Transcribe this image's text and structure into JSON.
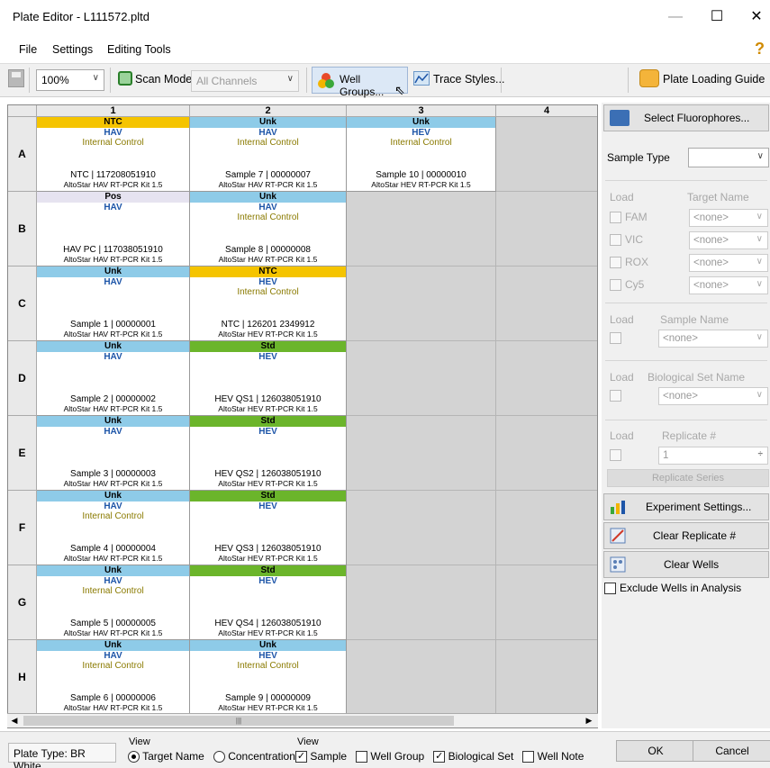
{
  "window": {
    "title": "Plate Editor - L111572.pltd",
    "minimize": "—",
    "maximize": "☐",
    "close": "✕"
  },
  "menu": {
    "items": [
      "File",
      "Settings",
      "Editing Tools"
    ],
    "help": "?"
  },
  "toolbar": {
    "zoom": "100%",
    "scan_mode_label": "Scan Mode",
    "channels": "All Channels",
    "well_groups": "Well Groups...",
    "trace_styles": "Trace Styles...",
    "plate_loading_guide": "Plate Loading Guide"
  },
  "grid": {
    "columns": [
      "1",
      "2",
      "3",
      "4"
    ],
    "rows": [
      "A",
      "B",
      "C",
      "D",
      "E",
      "F",
      "G",
      "H"
    ],
    "wells": [
      [
        {
          "type": "NTC",
          "color": "#f5c400",
          "t1": "HAV",
          "t2": "Internal Control",
          "s1": "NTC | 117208051910",
          "s2": "AltoStar HAV RT-PCR Kit 1.5"
        },
        {
          "type": "Unk",
          "color": "#8ecbe8",
          "t1": "HAV",
          "t2": "Internal Control",
          "s1": "Sample 7 | 00000007",
          "s2": "AltoStar HAV RT-PCR Kit 1.5"
        },
        {
          "type": "Unk",
          "color": "#8ecbe8",
          "t1": "HEV",
          "t2": "Internal Control",
          "s1": "Sample 10 | 00000010",
          "s2": "AltoStar HEV RT-PCR Kit 1.5"
        },
        null
      ],
      [
        {
          "type": "Pos",
          "color": "#e6e3f0",
          "t1": "HAV",
          "t2": "",
          "s1": "HAV PC | 117038051910",
          "s2": "AltoStar HAV RT-PCR Kit 1.5"
        },
        {
          "type": "Unk",
          "color": "#8ecbe8",
          "t1": "HAV",
          "t2": "Internal Control",
          "s1": "Sample 8 | 00000008",
          "s2": "AltoStar HAV RT-PCR Kit 1.5"
        },
        null,
        null
      ],
      [
        {
          "type": "Unk",
          "color": "#8ecbe8",
          "t1": "HAV",
          "t2": "",
          "s1": "Sample 1 | 00000001",
          "s2": "AltoStar HAV RT-PCR Kit 1.5"
        },
        {
          "type": "NTC",
          "color": "#f5c400",
          "t1": "HEV",
          "t2": "Internal Control",
          "s1": "NTC | 126201 2349912",
          "s2": "AltoStar HEV RT-PCR Kit 1.5"
        },
        null,
        null
      ],
      [
        {
          "type": "Unk",
          "color": "#8ecbe8",
          "t1": "HAV",
          "t2": "",
          "s1": "Sample 2 | 00000002",
          "s2": "AltoStar HAV RT-PCR Kit 1.5"
        },
        {
          "type": "Std",
          "color": "#6bb52b",
          "t1": "HEV",
          "t2": "",
          "s1": "HEV QS1 | 126038051910",
          "s2": "AltoStar HEV RT-PCR Kit 1.5"
        },
        null,
        null
      ],
      [
        {
          "type": "Unk",
          "color": "#8ecbe8",
          "t1": "HAV",
          "t2": "",
          "s1": "Sample 3 | 00000003",
          "s2": "AltoStar HAV RT-PCR Kit 1.5"
        },
        {
          "type": "Std",
          "color": "#6bb52b",
          "t1": "HEV",
          "t2": "",
          "s1": "HEV QS2 | 126038051910",
          "s2": "AltoStar HEV RT-PCR Kit 1.5"
        },
        null,
        null
      ],
      [
        {
          "type": "Unk",
          "color": "#8ecbe8",
          "t1": "HAV",
          "t2": "Internal Control",
          "s1": "Sample 4 | 00000004",
          "s2": "AltoStar HAV RT-PCR Kit 1.5"
        },
        {
          "type": "Std",
          "color": "#6bb52b",
          "t1": "HEV",
          "t2": "",
          "s1": "HEV QS3 | 126038051910",
          "s2": "AltoStar HEV RT-PCR Kit 1.5"
        },
        null,
        null
      ],
      [
        {
          "type": "Unk",
          "color": "#8ecbe8",
          "t1": "HAV",
          "t2": "Internal Control",
          "s1": "Sample 5 | 00000005",
          "s2": "AltoStar HAV RT-PCR Kit 1.5"
        },
        {
          "type": "Std",
          "color": "#6bb52b",
          "t1": "HEV",
          "t2": "",
          "s1": "HEV QS4 | 126038051910",
          "s2": "AltoStar HEV RT-PCR Kit 1.5"
        },
        null,
        null
      ],
      [
        {
          "type": "Unk",
          "color": "#8ecbe8",
          "t1": "HAV",
          "t2": "Internal Control",
          "s1": "Sample 6 | 00000006",
          "s2": "AltoStar HAV RT-PCR Kit 1.5"
        },
        {
          "type": "Unk",
          "color": "#8ecbe8",
          "t1": "HEV",
          "t2": "Internal Control",
          "s1": "Sample 9 | 00000009",
          "s2": "AltoStar HEV RT-PCR Kit 1.5"
        },
        null,
        null
      ]
    ],
    "scroll_thumb_glyph": "|||"
  },
  "panel": {
    "select_fluorophores": "Select Fluorophores...",
    "sample_type_label": "Sample Type",
    "load_label": "Load",
    "target_name_label": "Target Name",
    "fluorophores": [
      "FAM",
      "VIC",
      "ROX",
      "Cy5"
    ],
    "none": "<none>",
    "sample_name_label": "Sample Name",
    "bio_set_label": "Biological Set Name",
    "replicate_label": "Replicate #",
    "replicate_value": "1",
    "replicate_series": "Replicate Series",
    "experiment_settings": "Experiment Settings...",
    "clear_replicate": "Clear Replicate #",
    "clear_wells": "Clear Wells",
    "exclude_wells": "Exclude Wells in Analysis"
  },
  "bottom": {
    "plate_type": "Plate Type: BR White",
    "view_label": "View",
    "target_name": "Target Name",
    "concentration": "Concentration",
    "view_label2": "View",
    "sample": "Sample",
    "well_group": "Well Group",
    "biological_set": "Biological Set",
    "well_note": "Well Note",
    "ok": "OK",
    "cancel": "Cancel"
  }
}
